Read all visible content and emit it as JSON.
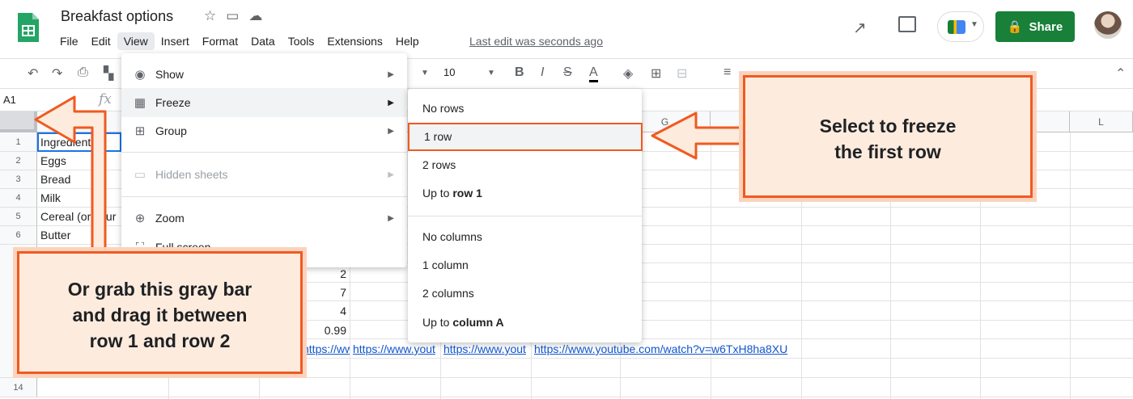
{
  "doc": {
    "title": "Breakfast options",
    "last_edit": "Last edit was seconds ago"
  },
  "menu": [
    "File",
    "Edit",
    "View",
    "Insert",
    "Format",
    "Data",
    "Tools",
    "Extensions",
    "Help"
  ],
  "share_label": "Share",
  "toolbar": {
    "font_size": "10"
  },
  "name_box": "A1",
  "fx_label": "fx",
  "columns": [
    "G",
    "L"
  ],
  "row_numbers": [
    "1",
    "2",
    "3",
    "4",
    "5",
    "6",
    "",
    "",
    "",
    "",
    "",
    "",
    "14"
  ],
  "cells": {
    "a1": "Ingredient",
    "a2": "Eggs",
    "a3": "Bread",
    "a4": "Milk",
    "a5": "Cereal (or your",
    "a6": "Butter",
    "c8": "2",
    "c9": "7",
    "c10": "4",
    "c11": "0.99",
    "link1": "https://www.yout",
    "link2": "https://www.yout",
    "link3": "https://www.yout",
    "link4": "https://www.youtube.com/watch?v=w6TxH8ha8XU"
  },
  "view_menu": {
    "show": "Show",
    "freeze": "Freeze",
    "group": "Group",
    "hidden_sheets": "Hidden sheets",
    "zoom": "Zoom",
    "full_screen": "Full screen"
  },
  "freeze_menu": {
    "no_rows": "No rows",
    "one_row": "1 row",
    "two_rows": "2 rows",
    "up_to_row_prefix": "Up to",
    "up_to_row_bold": "row 1",
    "no_columns": "No columns",
    "one_column": "1 column",
    "two_columns": "2 columns",
    "up_to_col_prefix": "Up to",
    "up_to_col_bold": "column A"
  },
  "callouts": {
    "freeze_line1": "Select to freeze",
    "freeze_line2": "the first row",
    "drag_line1": "Or grab this gray bar",
    "drag_line2": "and drag it between",
    "drag_line3": "row 1 and row 2"
  },
  "colors": {
    "accent": "#f05a20",
    "callout_bg": "#fdecde",
    "share": "#188038",
    "link": "#1155cc"
  }
}
